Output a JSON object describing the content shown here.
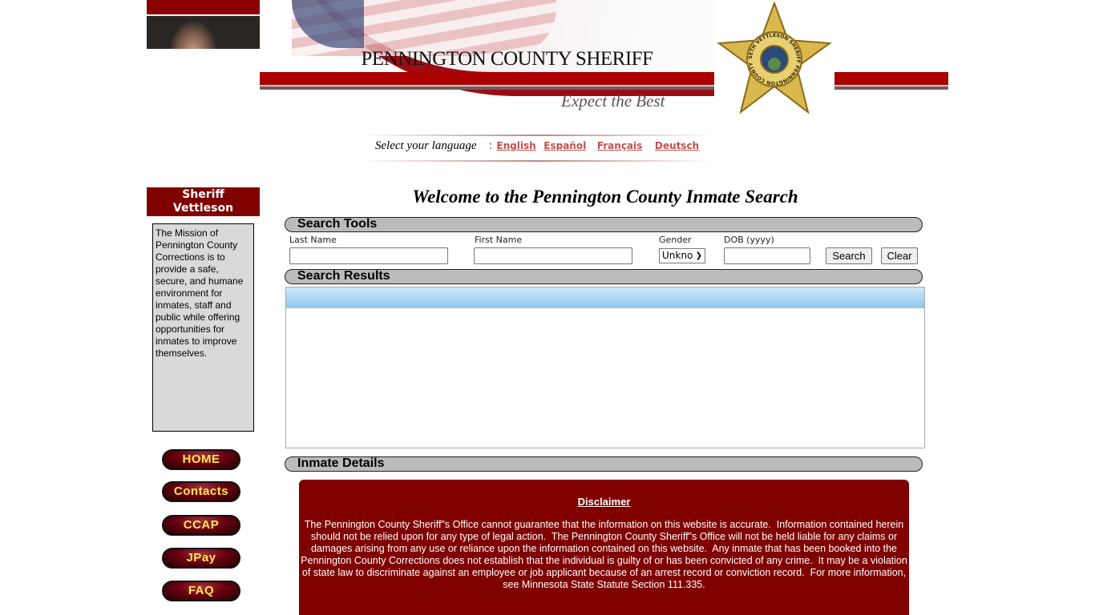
{
  "header": {
    "title": "PENNINGTON COUNTY SHERIFF",
    "tagline": "Expect the Best",
    "badge_text": "SETH VETTLESON SHERIFF PENNINGTON COUNTY"
  },
  "language": {
    "label": "Select your language",
    "separator": ":",
    "options": [
      "English",
      "Español",
      "Français",
      "Deutsch"
    ]
  },
  "sidebar": {
    "sheriff_line1": "Sheriff",
    "sheriff_line2": "Vettleson",
    "mission": "The Mission of Pennington County Corrections is to provide a safe, secure, and humane environment for inmates, staff and public while offering opportunities for inmates to improve themselves.",
    "nav": [
      "HOME",
      "Contacts",
      "CCAP",
      "JPay",
      "FAQ"
    ]
  },
  "main": {
    "welcome": "Welcome to the Pennington County Inmate Search",
    "search_tools": {
      "title": "Search Tools",
      "last_name_label": "Last Name",
      "last_name_value": "",
      "first_name_label": "First Name",
      "first_name_value": "",
      "gender_label": "Gender",
      "gender_value": "Unkno",
      "dob_label": "DOB (yyyy)",
      "dob_value": "",
      "search_button": "Search",
      "clear_button": "Clear"
    },
    "search_results": {
      "title": "Search Results"
    },
    "inmate_details": {
      "title": "Inmate Details"
    },
    "disclaimer": {
      "title": "Disclaimer",
      "text": "The Pennington County Sheriff\"s Office cannot guarantee that the information on this website is accurate.  Information contained herein should not be relied upon for any type of legal action.  The Pennington County Sheriff\"s Office will not be held liable for any claims or damages arising from any use or reliance upon the information contained on this website.  Any inmate that has been booked into the Pennington County Corrections does not establish that the individual is guilty of or has been convicted of any crime.  It may be a violation of state law to discriminate against an employee or job applicant because of an arrest record or conviction record.  For more information, see Minnesota State Statute Section 111.335."
    }
  },
  "colors": {
    "brand_red": "#800000",
    "nav_text": "#ffe84a",
    "link": "#c0504d"
  }
}
